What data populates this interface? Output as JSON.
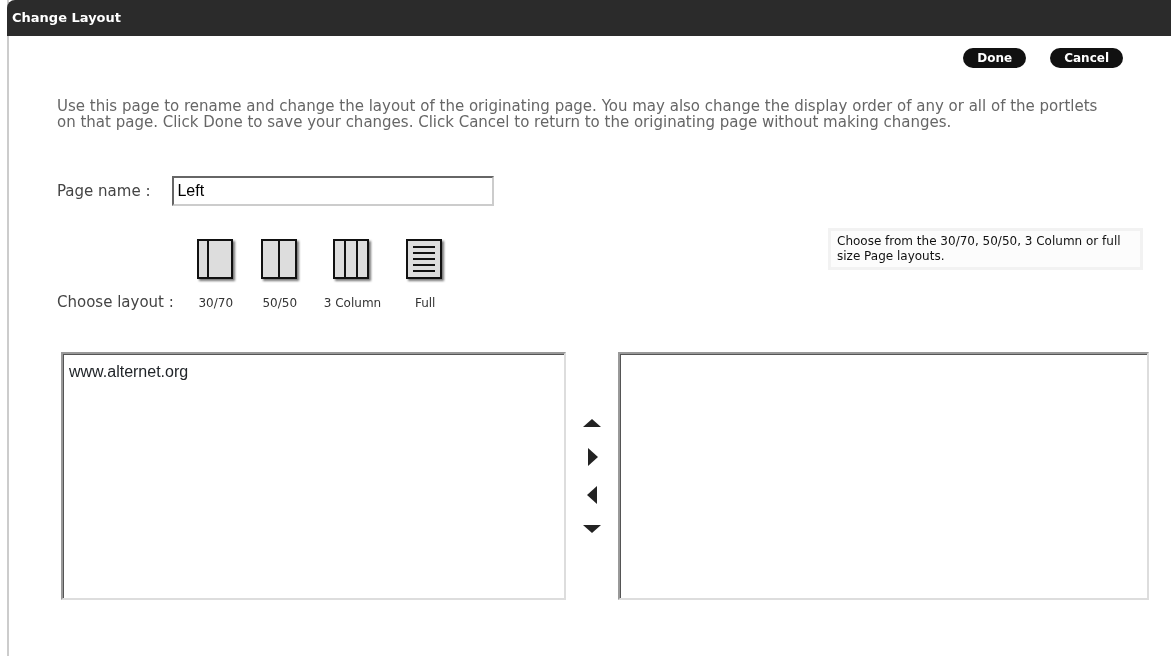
{
  "window": {
    "title": "Change Layout"
  },
  "buttons": [
    "Done",
    "Cancel"
  ],
  "intro": "Use this page to rename and change the layout of the originating page. You may also change the display order of any or all of the portlets on that page. Click Done to save your changes. Click Cancel to return to the originating page without making changes.",
  "page_name": {
    "label": "Page name :",
    "value": "Left"
  },
  "layout": {
    "label": "Choose layout :",
    "options": [
      {
        "kind": "split3070",
        "label": "30/70"
      },
      {
        "kind": "split5050",
        "label": "50/50"
      },
      {
        "kind": "three",
        "label": "3 Column"
      },
      {
        "kind": "full",
        "label": "Full"
      }
    ],
    "hint": "Choose from the 30/70, 50/50, 3 Column or full size Page layouts."
  },
  "left_list": {
    "items": [
      "www.alternet.org"
    ]
  }
}
